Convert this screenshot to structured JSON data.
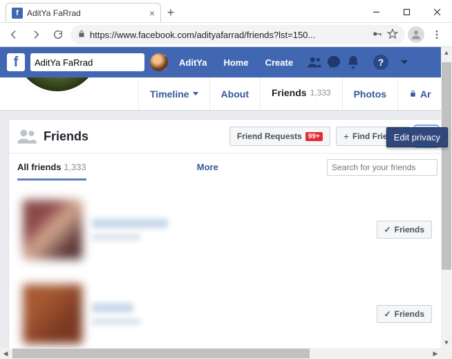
{
  "browser": {
    "tab_title": "AditYa FaRrad",
    "url_display": "https://www.facebook.com/adityafarrad/friends?lst=150..."
  },
  "fb_nav": {
    "search_value": "AditYa FaRrad",
    "profile_name": "AditYa",
    "links": {
      "home": "Home",
      "create": "Create"
    }
  },
  "profile_tabs": {
    "timeline": "Timeline",
    "about": "About",
    "friends": "Friends",
    "friends_count": "1,333",
    "photos": "Photos",
    "archive_short": "Ar"
  },
  "friends_panel": {
    "heading": "Friends",
    "friend_requests_label": "Friend Requests",
    "friend_requests_badge": "99+",
    "find_friends_label": "Find Friends",
    "tooltip": "Edit privacy",
    "subhead": {
      "all_friends": "All friends",
      "count": "1,333",
      "more": "More",
      "search_placeholder": "Search for your friends"
    },
    "item_button": "Friends"
  }
}
